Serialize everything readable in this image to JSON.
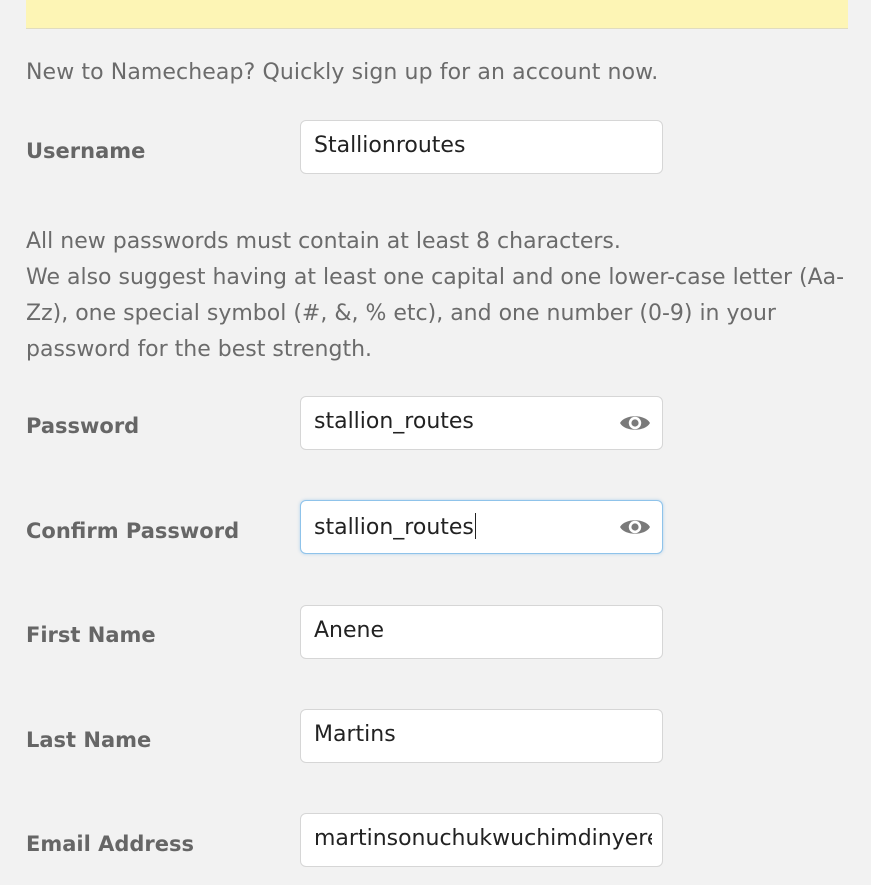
{
  "intro_text": "New to Namecheap? Quickly sign up for an account now.",
  "password_hint": {
    "line1": "All new passwords must contain at least 8 characters.",
    "line2": "We also suggest having at least one capital and one lower-case letter (Aa-",
    "line3": "Zz), one special symbol (#, &, % etc), and one number (0-9) in your",
    "line4": "password for the best strength."
  },
  "fields": {
    "username": {
      "label": "Username",
      "value": "Stallionroutes"
    },
    "password": {
      "label": "Password",
      "value": "stallion_routes",
      "icon": "eye-icon"
    },
    "confirm_password": {
      "label": "Confirm Password",
      "value": "stallion_routes",
      "icon": "eye-icon"
    },
    "first_name": {
      "label": "First Name",
      "value": "Anene"
    },
    "last_name": {
      "label": "Last Name",
      "value": "Martins"
    },
    "email": {
      "label": "Email Address",
      "value": "martinsonuchukwuchimdinyere"
    }
  },
  "colors": {
    "notice_bar": "#fdf5b5",
    "focus_border": "#8fc3ea",
    "label_text": "#666666"
  }
}
